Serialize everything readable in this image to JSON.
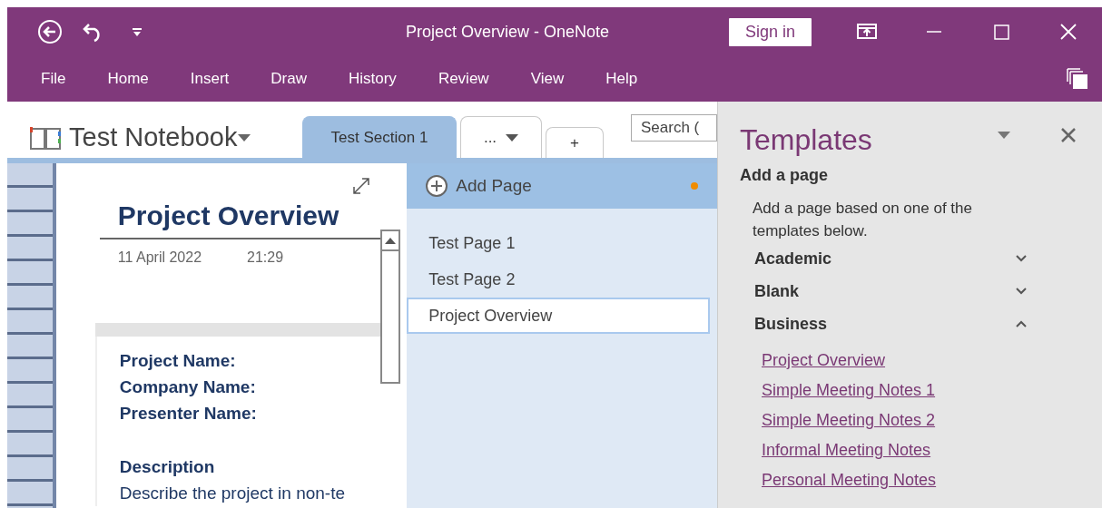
{
  "window": {
    "title": "Project Overview  -  OneNote",
    "sign_in": "Sign in"
  },
  "ribbon_tabs": [
    {
      "label": "File",
      "selected": false
    },
    {
      "label": "Home",
      "selected": false
    },
    {
      "label": "Insert",
      "selected": false
    },
    {
      "label": "Draw",
      "selected": false
    },
    {
      "label": "History",
      "selected": false
    },
    {
      "label": "Review",
      "selected": false
    },
    {
      "label": "View",
      "selected": false
    },
    {
      "label": "Help",
      "selected": false
    }
  ],
  "notebook": {
    "name": "Test Notebook"
  },
  "section_tabs": [
    {
      "kind": "section",
      "label": "Test Section 1",
      "selected": true
    },
    {
      "kind": "overflow",
      "label": "...",
      "selected": false
    },
    {
      "kind": "add",
      "label": "+",
      "selected": false
    }
  ],
  "search": {
    "placeholder": "Search ("
  },
  "page_list": {
    "add_page": "Add Page",
    "pages": [
      {
        "title": "Test Page 1",
        "selected": false
      },
      {
        "title": "Test Page 2",
        "selected": false
      },
      {
        "title": "Project Overview",
        "selected": true
      }
    ]
  },
  "note": {
    "title": "Project Overview",
    "date": "11 April 2022",
    "time": "21:29",
    "fields": [
      "Project Name:",
      "Company Name:",
      "Presenter Name:"
    ],
    "heading": "Description",
    "body": "Describe the project in non-te"
  },
  "templates": {
    "title": "Templates",
    "section": "Add a page",
    "description": "Add a page based on one of the templates below.",
    "categories": [
      {
        "name": "Academic",
        "expanded": false
      },
      {
        "name": "Blank",
        "expanded": false
      },
      {
        "name": "Business",
        "expanded": true,
        "items": [
          "Project Overview",
          "Simple Meeting Notes 1",
          "Simple Meeting Notes 2",
          "Informal Meeting Notes",
          "Personal Meeting Notes"
        ]
      }
    ]
  }
}
